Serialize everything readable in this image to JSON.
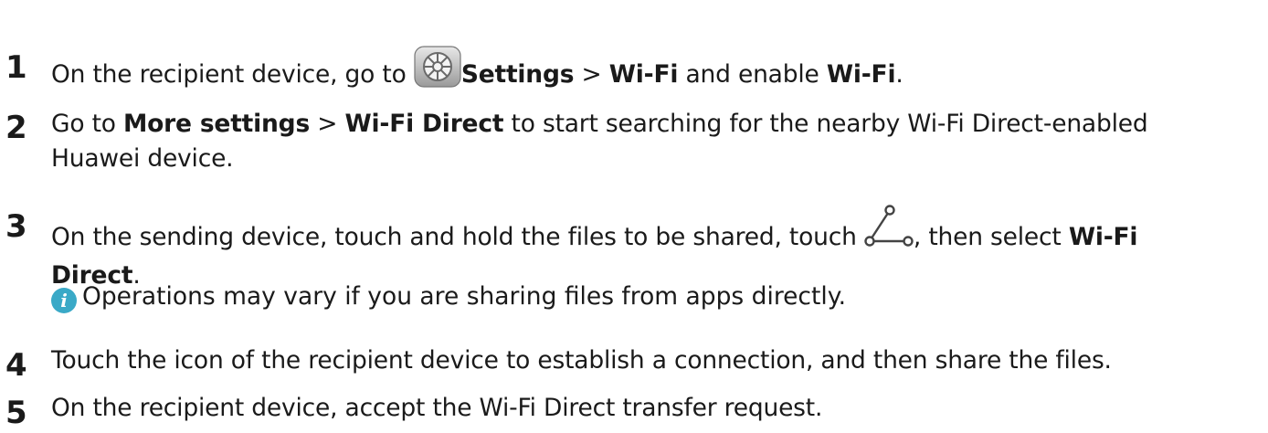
{
  "steps": [
    {
      "number": "1",
      "parts": {
        "a": "On the recipient device, go to ",
        "b": "Settings",
        "c": " > ",
        "d": "Wi-Fi",
        "e": " and enable ",
        "f": "Wi-Fi",
        "g": "."
      }
    },
    {
      "number": "2",
      "parts": {
        "a": "Go to ",
        "b": "More settings",
        "c": " > ",
        "d": "Wi-Fi Direct",
        "e": " to start searching for the nearby Wi-Fi Direct-enabled",
        "f": "Huawei device."
      }
    },
    {
      "number": "3",
      "parts": {
        "a": "On the sending device, touch and hold the files to be shared, touch ",
        "b": ", then select ",
        "c": "Wi-Fi",
        "d": "Direct",
        "e": "."
      },
      "note": "Operations may vary if you are sharing files from apps directly."
    },
    {
      "number": "4",
      "text": "Touch the icon of the recipient device to establish a connection, and then share the files."
    },
    {
      "number": "5",
      "text": "On the recipient device, accept the Wi-Fi Direct transfer request."
    }
  ],
  "icons": {
    "settings": "settings-gear-icon",
    "share": "share-icon",
    "info": "info-icon",
    "info_color": "#3aa9c7"
  }
}
